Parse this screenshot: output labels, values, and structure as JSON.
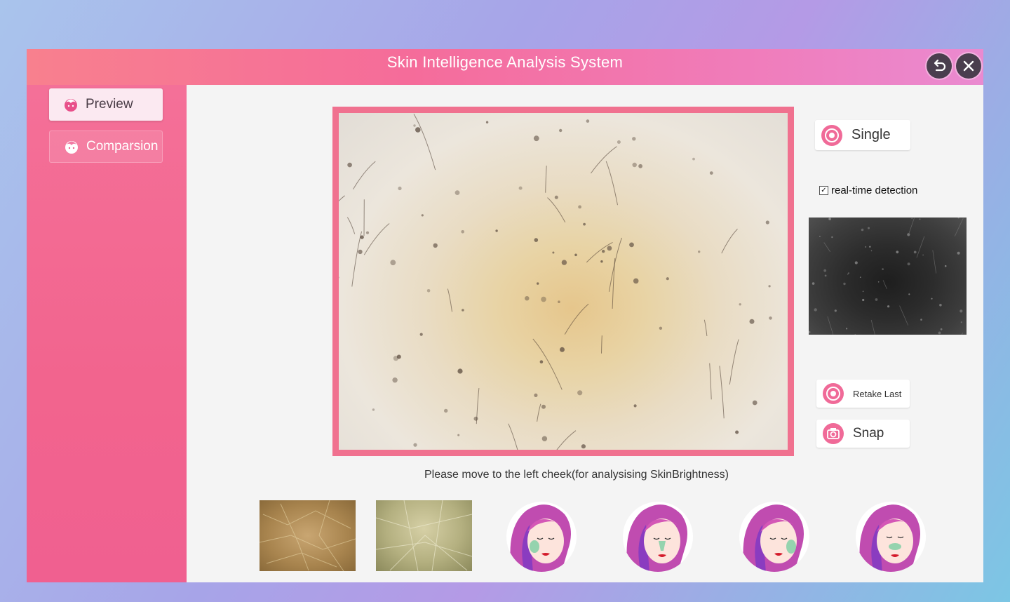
{
  "window": {
    "title": "Skin Intelligence Analysis System",
    "back_icon": "undo-icon",
    "close_icon": "close-icon"
  },
  "sidebar": {
    "items": [
      {
        "label": "Preview",
        "icon": "face-icon",
        "active": true
      },
      {
        "label": "Comparsion",
        "icon": "face-compare-icon",
        "active": false
      }
    ]
  },
  "controls": {
    "single_label": "Single",
    "realtime_label": "real-time detection",
    "realtime_checked": true,
    "retake_label": "Retake Last",
    "snap_label": "Snap"
  },
  "main": {
    "hint": "Please move to the left cheek(for analysising SkinBrightness)"
  },
  "colors": {
    "accent": "#f0718f",
    "sidebar": "#f2648e",
    "title_gradient_start": "#f8808e",
    "title_gradient_end": "#ea8ad0"
  },
  "thumbnails": [
    {
      "kind": "captured-skin-photo",
      "tone": "brown"
    },
    {
      "kind": "captured-skin-photo",
      "tone": "olive"
    },
    {
      "kind": "face-position-guide",
      "zone": "left-cheek"
    },
    {
      "kind": "face-position-guide",
      "zone": "nose"
    },
    {
      "kind": "face-position-guide",
      "zone": "right-cheek"
    },
    {
      "kind": "face-position-guide",
      "zone": "nose-bridge"
    }
  ]
}
